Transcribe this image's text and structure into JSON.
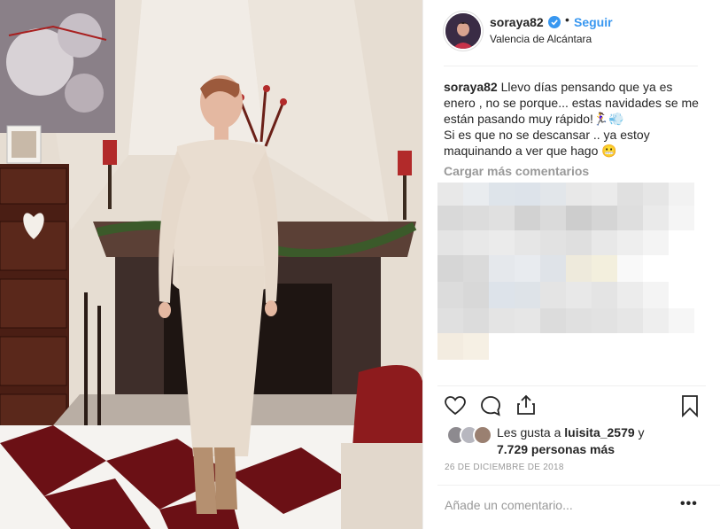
{
  "post": {
    "username": "soraya82",
    "verified": true,
    "separator": "•",
    "follow_label": "Seguir",
    "location": "Valencia de Alcántara",
    "caption_user": "soraya82",
    "caption_text": "Llevo días pensando que ya es enero , no se porque... estas navidades se me están pasando muy rápido!🏃‍♀️💨",
    "caption_text2": "Si es que no se descansar .. ya estoy maquinando a ver que hago 😬",
    "load_more": "Cargar más comentarios",
    "likes_prefix": "Les gusta a ",
    "likes_user": "luisita_2579",
    "likes_and": " y",
    "likes_count": "7.729 personas más",
    "date": "26 DE DICIEMBRE DE 2018",
    "add_comment_placeholder": "Añade un comentario...",
    "more_label": "•••"
  },
  "icons": {
    "like": "heart-icon",
    "comment": "comment-icon",
    "share": "share-icon",
    "save": "bookmark-icon",
    "verified": "verified-badge-icon",
    "more": "more-options-icon"
  },
  "colors": {
    "accent": "#3897f0",
    "text": "#262626",
    "muted": "#999999",
    "divider": "#efefef"
  }
}
